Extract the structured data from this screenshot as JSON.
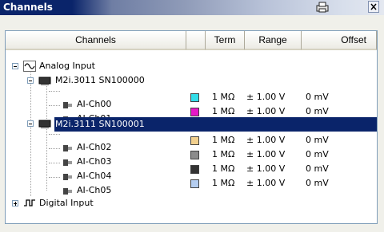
{
  "window": {
    "title": "Channels"
  },
  "columns": [
    "Channels",
    "",
    "Term",
    "Range",
    "Offset"
  ],
  "tree": {
    "analog": {
      "label": "Analog Input"
    },
    "devices": [
      {
        "label": "M2i.3011 SN100000",
        "channels": [
          {
            "name": "AI-Ch00",
            "color": "#33dde8",
            "term": "1 MΩ",
            "range": "± 1.00 V",
            "offset": "0 mV"
          },
          {
            "name": "AI-Ch01",
            "color": "#e619c8",
            "term": "1 MΩ",
            "range": "± 1.00 V",
            "offset": "0 mV"
          }
        ]
      },
      {
        "label": "M2i.3111 SN100001",
        "channels": [
          {
            "name": "AI-Ch02",
            "color": "#f2d08e",
            "term": "1 MΩ",
            "range": "± 1.00 V",
            "offset": "0 mV"
          },
          {
            "name": "AI-Ch03",
            "color": "#8c8c8c",
            "term": "1 MΩ",
            "range": "± 1.00 V",
            "offset": "0 mV"
          },
          {
            "name": "AI-Ch04",
            "color": "#333333",
            "term": "1 MΩ",
            "range": "± 1.00 V",
            "offset": "0 mV"
          },
          {
            "name": "AI-Ch05",
            "color": "#b4cdf0",
            "term": "1 MΩ",
            "range": "± 1.00 V",
            "offset": "0 mV"
          }
        ]
      }
    ],
    "digital": {
      "label": "Digital Input"
    }
  }
}
